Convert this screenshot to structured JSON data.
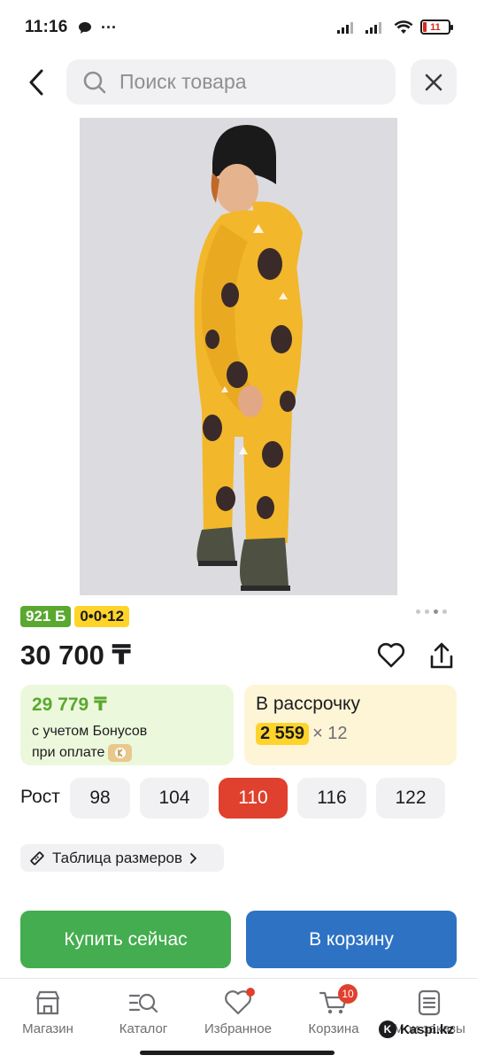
{
  "status_bar": {
    "time": "11:16",
    "extra": "···",
    "battery": "11"
  },
  "search": {
    "placeholder": "Поиск товара"
  },
  "product": {
    "image_alt": "Детский комбинезон с принтом обезьян",
    "image_dots": 4,
    "active_dot": 3
  },
  "badges": {
    "bonus": "921 Б",
    "installment": "0•0•12"
  },
  "price": "30 700 ₸",
  "bonus_card": {
    "amount": "29 779 ₸",
    "line1": "с учетом Бонусов",
    "line2": "при оплате"
  },
  "installment_card": {
    "label": "В рассрочку",
    "monthly": "2 559",
    "multiplier": "× 12"
  },
  "sizes": {
    "label": "Рост",
    "options": [
      "98",
      "104",
      "110",
      "116",
      "122"
    ],
    "selected": "110"
  },
  "size_table": {
    "label": "Таблица размеров"
  },
  "actions": {
    "buy_now": "Купить сейчас",
    "add_to_cart": "В корзину"
  },
  "nav": {
    "items": [
      {
        "label": "Магазин",
        "icon": "shop-icon"
      },
      {
        "label": "Каталог",
        "icon": "catalog-search-icon"
      },
      {
        "label": "Избранное",
        "icon": "heart-icon"
      },
      {
        "label": "Корзина",
        "icon": "cart-icon",
        "badge": "10"
      },
      {
        "label": "Мои заказы",
        "icon": "orders-icon"
      }
    ]
  },
  "watermark": "Kaspi.kz",
  "colors": {
    "accent_red": "#e0402e",
    "buy_green": "#44ad4f",
    "cart_blue": "#2e72c4",
    "bonus_green": "#5aa82f",
    "installment_yellow": "#ffd42a"
  }
}
